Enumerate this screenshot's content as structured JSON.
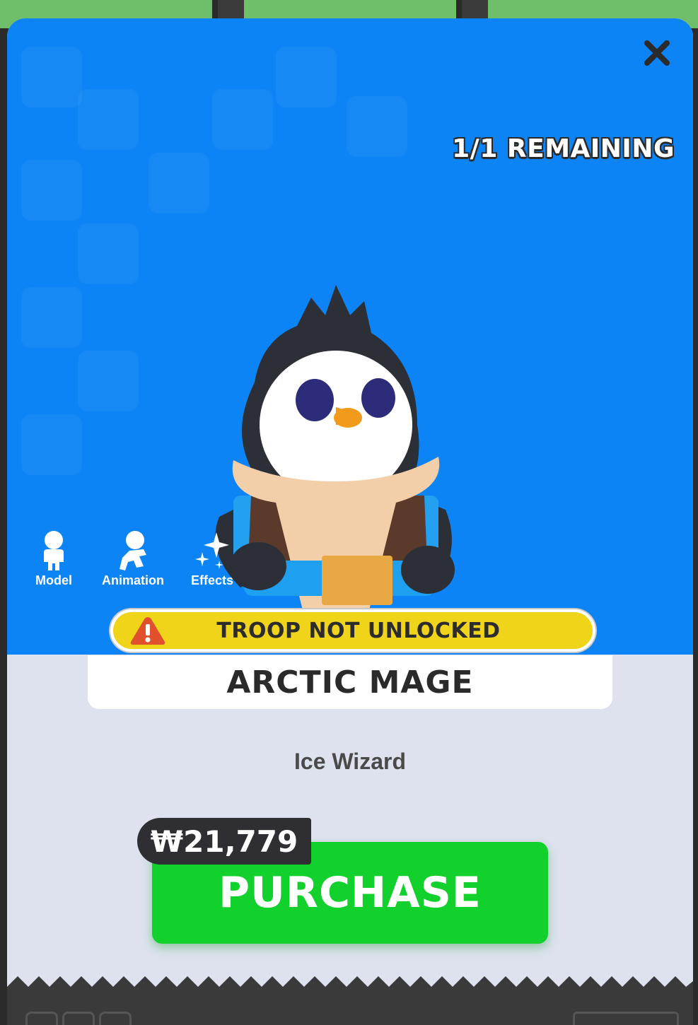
{
  "header": {
    "close_icon": "close-icon",
    "remaining_text": "1/1 REMAINING"
  },
  "view_tabs": [
    {
      "label": "Model",
      "icon": "person-icon"
    },
    {
      "label": "Animation",
      "icon": "running-person-icon"
    },
    {
      "label": "Effects",
      "icon": "sparkle-icon"
    }
  ],
  "character": {
    "depiction": "penguin-wizard-character"
  },
  "status_banner": {
    "text": "TROOP NOT UNLOCKED",
    "icon": "warning-icon"
  },
  "item": {
    "name": "ARCTIC MAGE",
    "subtitle": "Ice Wizard"
  },
  "purchase": {
    "price": "₩21,779",
    "button_label": "PURCHASE"
  },
  "colors": {
    "hero_background": "#0d84f5",
    "banner_yellow": "#f0d41a",
    "purchase_green": "#12d12c",
    "panel_background": "#dde2ee"
  }
}
